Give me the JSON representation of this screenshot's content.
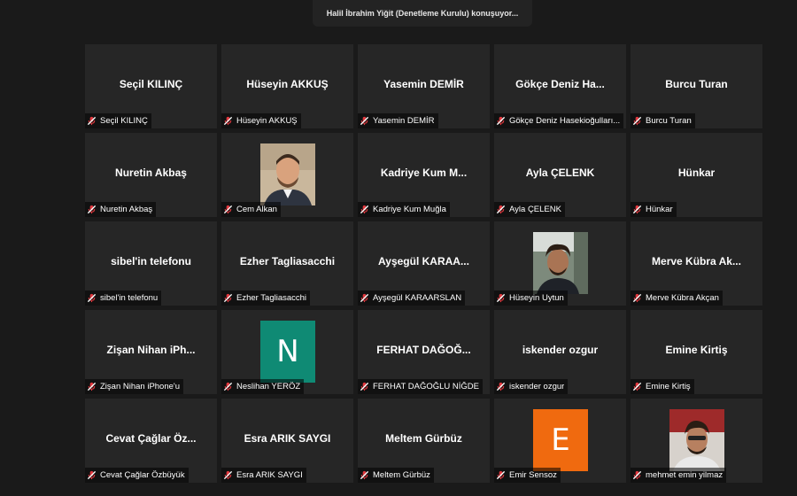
{
  "speaker": {
    "text": "Halil İbrahim Yiğit (Denetleme Kurulu) konuşuyor..."
  },
  "colors": {
    "background": "#1a1a1a",
    "tile": "#262626",
    "mute_icon": "#e0383e",
    "avatar_n": "#0f8a74",
    "avatar_e": "#f06a0f"
  },
  "participants": [
    {
      "title": "Seçil KILINÇ",
      "label": "Seçil KILINÇ",
      "muted_icon": "mic-muted-icon"
    },
    {
      "title": "Hüseyin AKKUŞ",
      "label": "Hüseyin AKKUŞ",
      "muted_icon": "mic-muted-icon"
    },
    {
      "title": "Yasemin DEMİR",
      "label": "Yasemin DEMİR",
      "muted_icon": "mic-muted-icon"
    },
    {
      "title": "Gökçe Deniz Ha...",
      "label": "Gökçe Deniz Hasekioğulları...",
      "muted_icon": "mic-muted-icon"
    },
    {
      "title": "Burcu Turan",
      "label": "Burcu Turan",
      "muted_icon": "mic-muted-icon"
    },
    {
      "title": "Nuretin Akbaş",
      "label": "Nuretin Akbaş",
      "muted_icon": "mic-muted-icon"
    },
    {
      "title": "",
      "label": "Cem Alkan",
      "muted_icon": "mic-muted-icon",
      "avatar": "profile-photo"
    },
    {
      "title": "Kadriye Kum M...",
      "label": "Kadriye Kum Muğla",
      "muted_icon": "mic-muted-icon"
    },
    {
      "title": "Ayla ÇELENK",
      "label": "Ayla ÇELENK",
      "muted_icon": "mic-muted-icon"
    },
    {
      "title": "Hünkar",
      "label": "Hünkar",
      "muted_icon": "mic-muted-icon"
    },
    {
      "title": "sibel'in telefonu",
      "label": "sibel'in telefonu",
      "muted_icon": "mic-muted-icon"
    },
    {
      "title": "Ezher Tagliasacchi",
      "label": "Ezher Tagliasacchi",
      "muted_icon": "mic-muted-icon"
    },
    {
      "title": "Ayşegül KARAA...",
      "label": "Ayşegül KARAARSLAN",
      "muted_icon": "mic-muted-icon"
    },
    {
      "title": "",
      "label": "Hüseyin Uytun",
      "muted_icon": "mic-muted-icon",
      "avatar": "profile-photo"
    },
    {
      "title": "Merve Kübra Ak...",
      "label": "Merve Kübra Akçan",
      "muted_icon": "mic-muted-icon"
    },
    {
      "title": "Zişan Nihan iPh...",
      "label": "Zişan Nihan iPhone'u",
      "muted_icon": "mic-muted-icon"
    },
    {
      "title": "",
      "label": "Neslihan YERÖZ",
      "muted_icon": "mic-muted-icon",
      "avatar_letter": "N"
    },
    {
      "title": "FERHAT DAĞOĞ...",
      "label": "FERHAT DAĞOĞLU NİĞDE",
      "muted_icon": "mic-muted-icon"
    },
    {
      "title": "iskender ozgur",
      "label": "iskender ozgur",
      "muted_icon": "mic-muted-icon"
    },
    {
      "title": "Emine Kirtiş",
      "label": "Emine Kirtiş",
      "muted_icon": "mic-muted-icon"
    },
    {
      "title": "Cevat Çağlar Öz...",
      "label": "Cevat Çağlar Özbüyük",
      "muted_icon": "mic-muted-icon"
    },
    {
      "title": "Esra ARIK SAYGI",
      "label": "Esra ARIK SAYGI",
      "muted_icon": "mic-muted-icon"
    },
    {
      "title": "Meltem Gürbüz",
      "label": "Meltem Gürbüz",
      "muted_icon": "mic-muted-icon"
    },
    {
      "title": "",
      "label": "Emir Sensoz",
      "muted_icon": "mic-muted-icon",
      "avatar_letter": "E"
    },
    {
      "title": "",
      "label": "mehmet emin yilmaz",
      "muted_icon": "mic-muted-icon",
      "avatar": "profile-photo"
    }
  ]
}
